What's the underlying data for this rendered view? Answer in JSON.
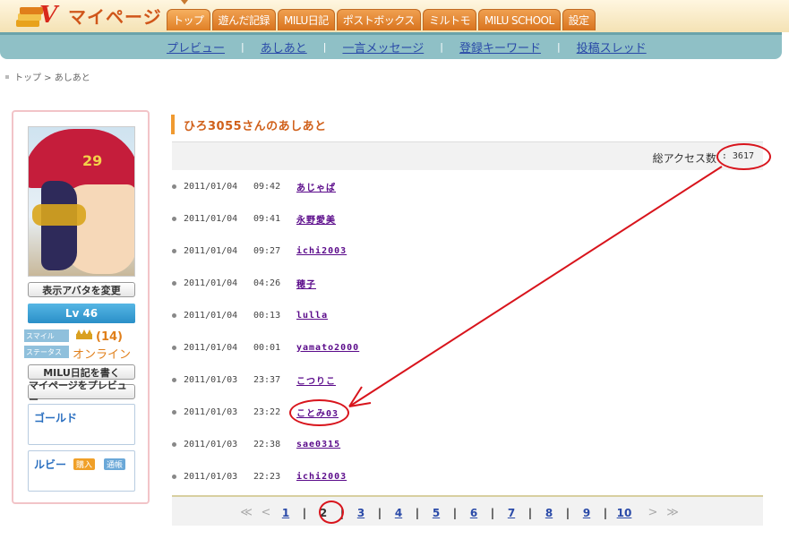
{
  "header": {
    "title": "マイページ",
    "tabs": [
      {
        "label": "トップ",
        "active": true
      },
      {
        "label": "遊んだ記録"
      },
      {
        "label": "MILU日記"
      },
      {
        "label": "ポストボックス"
      },
      {
        "label": "ミルトモ"
      },
      {
        "label": "MILU SCHOOL"
      },
      {
        "label": "設定"
      }
    ]
  },
  "subnav": {
    "links": [
      "プレビュー",
      "あしあと",
      "一言メッセージ",
      "登録キーワード",
      "投稿スレッド"
    ],
    "separator": "|"
  },
  "breadcrumb": {
    "text": "トップ > あしあと"
  },
  "sidebar": {
    "avatar_cap_text": "29",
    "change_avatar": "表示アバタを変更",
    "level": "Lv 46",
    "smile_label": "スマイル",
    "smile_count": "(14)",
    "status_label": "ステータス",
    "status_value": "オンライン",
    "write_diary": "MILU日記を書く",
    "preview_mypage": "マイページをプレビュー",
    "gold_label": "ゴールド",
    "ruby_label": "ルビー",
    "buy_label": "購入",
    "passbook_label": "通帳"
  },
  "main": {
    "title": "ひろ3055さんのあしあと",
    "access_label": "総アクセス数",
    "access_value": ": 3617",
    "rows": [
      {
        "date": "2011/01/04",
        "time": "09:42",
        "user": "あじゃぱ"
      },
      {
        "date": "2011/01/04",
        "time": "09:41",
        "user": "永野愛美"
      },
      {
        "date": "2011/01/04",
        "time": "09:27",
        "user": "ichi2003"
      },
      {
        "date": "2011/01/04",
        "time": "04:26",
        "user": "穂子"
      },
      {
        "date": "2011/01/04",
        "time": "00:13",
        "user": "lulla"
      },
      {
        "date": "2011/01/04",
        "time": "00:01",
        "user": "yamato2000"
      },
      {
        "date": "2011/01/03",
        "time": "23:37",
        "user": "こつりこ"
      },
      {
        "date": "2011/01/03",
        "time": "23:22",
        "user": "ことみ03"
      },
      {
        "date": "2011/01/03",
        "time": "22:38",
        "user": "sae0315"
      },
      {
        "date": "2011/01/03",
        "time": "22:23",
        "user": "ichi2003"
      }
    ]
  },
  "pager": {
    "first": "≪",
    "prev": "<",
    "pages": [
      "1",
      "2",
      "3",
      "4",
      "5",
      "6",
      "7",
      "8",
      "9",
      "10"
    ],
    "current": "2",
    "next": ">",
    "last": "≫",
    "separator": "|"
  },
  "annotation_color": "#d8141c",
  "icons": {
    "crown": "crown-icon",
    "logo": "books-logo-icon"
  }
}
